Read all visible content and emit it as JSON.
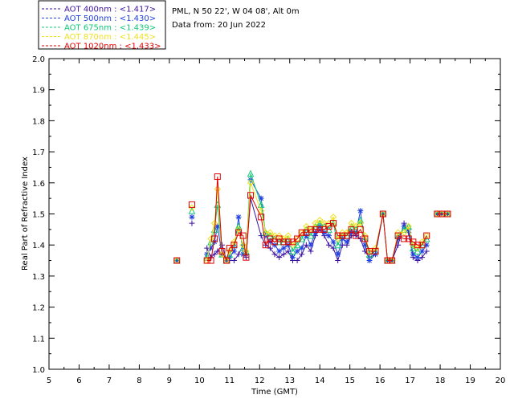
{
  "header": {
    "station": "PML, N 50 22', W 04 08', Alt 0m",
    "data_from": "Data from: 20 Jun 2022"
  },
  "legend": [
    {
      "label": "AOT  400nm : <1.417>",
      "color": "#3b10a0",
      "marker": "plus"
    },
    {
      "label": "AOT  500nm : <1.430>",
      "color": "#2040e0",
      "marker": "star"
    },
    {
      "label": "AOT  675nm : <1.439>",
      "color": "#10c878",
      "marker": "triangle"
    },
    {
      "label": "AOT  870nm : <1.445>",
      "color": "#f0e020",
      "marker": "diamond"
    },
    {
      "label": "AOT 1020nm : <1.433>",
      "color": "#e00000",
      "marker": "square"
    }
  ],
  "chart_data": {
    "type": "line",
    "xlabel": "Time (GMT)",
    "ylabel": "Real Part of Refractive Index",
    "xlim": [
      5,
      20
    ],
    "ylim": [
      1.0,
      2.0
    ],
    "xticks": [
      "5",
      "6",
      "7",
      "8",
      "9",
      "10",
      "11",
      "12",
      "13",
      "14",
      "15",
      "16",
      "17",
      "18",
      "19",
      "20"
    ],
    "yticks": [
      "1.0",
      "1.1",
      "1.2",
      "1.3",
      "1.4",
      "1.5",
      "1.6",
      "1.7",
      "1.8",
      "1.9",
      "2.0"
    ],
    "x": [
      9.25,
      9.75,
      10.25,
      10.38,
      10.5,
      10.6,
      10.75,
      10.9,
      11.0,
      11.15,
      11.3,
      11.45,
      11.55,
      11.7,
      12.05,
      12.2,
      12.35,
      12.5,
      12.65,
      12.8,
      12.95,
      13.1,
      13.25,
      13.4,
      13.55,
      13.7,
      13.85,
      14.0,
      14.15,
      14.3,
      14.45,
      14.6,
      14.75,
      14.9,
      15.05,
      15.2,
      15.35,
      15.5,
      15.65,
      15.85,
      16.1,
      16.25,
      16.4,
      16.6,
      16.8,
      16.95,
      17.1,
      17.25,
      17.4,
      17.55,
      17.9,
      18.05,
      18.25
    ],
    "series": [
      {
        "name": "AOT  400nm",
        "color": "#3b10a0",
        "values": [
          1.35,
          1.47,
          1.39,
          1.36,
          1.37,
          1.38,
          1.4,
          1.35,
          1.35,
          1.35,
          1.37,
          1.4,
          1.36,
          1.55,
          1.43,
          1.4,
          1.39,
          1.37,
          1.36,
          1.37,
          1.38,
          1.35,
          1.35,
          1.37,
          1.4,
          1.38,
          1.43,
          1.45,
          1.43,
          1.4,
          1.39,
          1.35,
          1.4,
          1.4,
          1.43,
          1.43,
          1.42,
          1.38,
          1.36,
          1.37,
          1.5,
          1.35,
          1.35,
          1.4,
          1.47,
          1.44,
          1.36,
          1.35,
          1.36,
          1.38,
          1.5,
          1.5,
          1.5
        ]
      },
      {
        "name": "AOT  500nm",
        "color": "#2040e0",
        "values": [
          1.35,
          1.49,
          1.37,
          1.39,
          1.41,
          1.46,
          1.37,
          1.35,
          1.36,
          1.38,
          1.49,
          1.37,
          1.37,
          1.61,
          1.55,
          1.43,
          1.41,
          1.4,
          1.38,
          1.39,
          1.4,
          1.36,
          1.38,
          1.39,
          1.43,
          1.4,
          1.44,
          1.46,
          1.44,
          1.43,
          1.41,
          1.37,
          1.42,
          1.41,
          1.44,
          1.44,
          1.51,
          1.4,
          1.35,
          1.37,
          1.5,
          1.35,
          1.35,
          1.42,
          1.46,
          1.45,
          1.37,
          1.36,
          1.38,
          1.4,
          1.5,
          1.5,
          1.5
        ]
      },
      {
        "name": "AOT  675nm",
        "color": "#10c878",
        "values": [
          1.35,
          1.51,
          1.36,
          1.41,
          1.45,
          1.53,
          1.37,
          1.35,
          1.37,
          1.4,
          1.46,
          1.39,
          1.38,
          1.63,
          1.53,
          1.44,
          1.43,
          1.42,
          1.41,
          1.41,
          1.42,
          1.38,
          1.4,
          1.42,
          1.45,
          1.43,
          1.46,
          1.47,
          1.46,
          1.45,
          1.47,
          1.4,
          1.43,
          1.43,
          1.46,
          1.45,
          1.48,
          1.42,
          1.37,
          1.38,
          1.5,
          1.35,
          1.35,
          1.43,
          1.45,
          1.46,
          1.39,
          1.38,
          1.4,
          1.42,
          1.5,
          1.5,
          1.5
        ]
      },
      {
        "name": "AOT  870nm",
        "color": "#f0e020",
        "values": [
          1.35,
          1.52,
          1.35,
          1.42,
          1.47,
          1.58,
          1.37,
          1.35,
          1.38,
          1.41,
          1.45,
          1.4,
          1.38,
          1.6,
          1.51,
          1.44,
          1.44,
          1.43,
          1.43,
          1.42,
          1.43,
          1.4,
          1.42,
          1.44,
          1.46,
          1.45,
          1.47,
          1.48,
          1.47,
          1.47,
          1.49,
          1.42,
          1.44,
          1.44,
          1.47,
          1.46,
          1.47,
          1.43,
          1.38,
          1.39,
          1.5,
          1.35,
          1.35,
          1.44,
          1.44,
          1.46,
          1.4,
          1.39,
          1.41,
          1.43,
          1.5,
          1.5,
          1.5
        ]
      },
      {
        "name": "AOT 1020nm",
        "color": "#e00000",
        "values": [
          1.35,
          1.53,
          1.35,
          1.35,
          1.42,
          1.62,
          1.38,
          1.35,
          1.39,
          1.4,
          1.44,
          1.43,
          1.36,
          1.56,
          1.49,
          1.4,
          1.42,
          1.41,
          1.42,
          1.41,
          1.41,
          1.41,
          1.42,
          1.44,
          1.44,
          1.45,
          1.45,
          1.45,
          1.45,
          1.46,
          1.47,
          1.43,
          1.43,
          1.43,
          1.45,
          1.43,
          1.45,
          1.42,
          1.38,
          1.38,
          1.5,
          1.35,
          1.35,
          1.43,
          1.42,
          1.42,
          1.41,
          1.4,
          1.4,
          1.43,
          1.5,
          1.5,
          1.5
        ]
      }
    ]
  }
}
